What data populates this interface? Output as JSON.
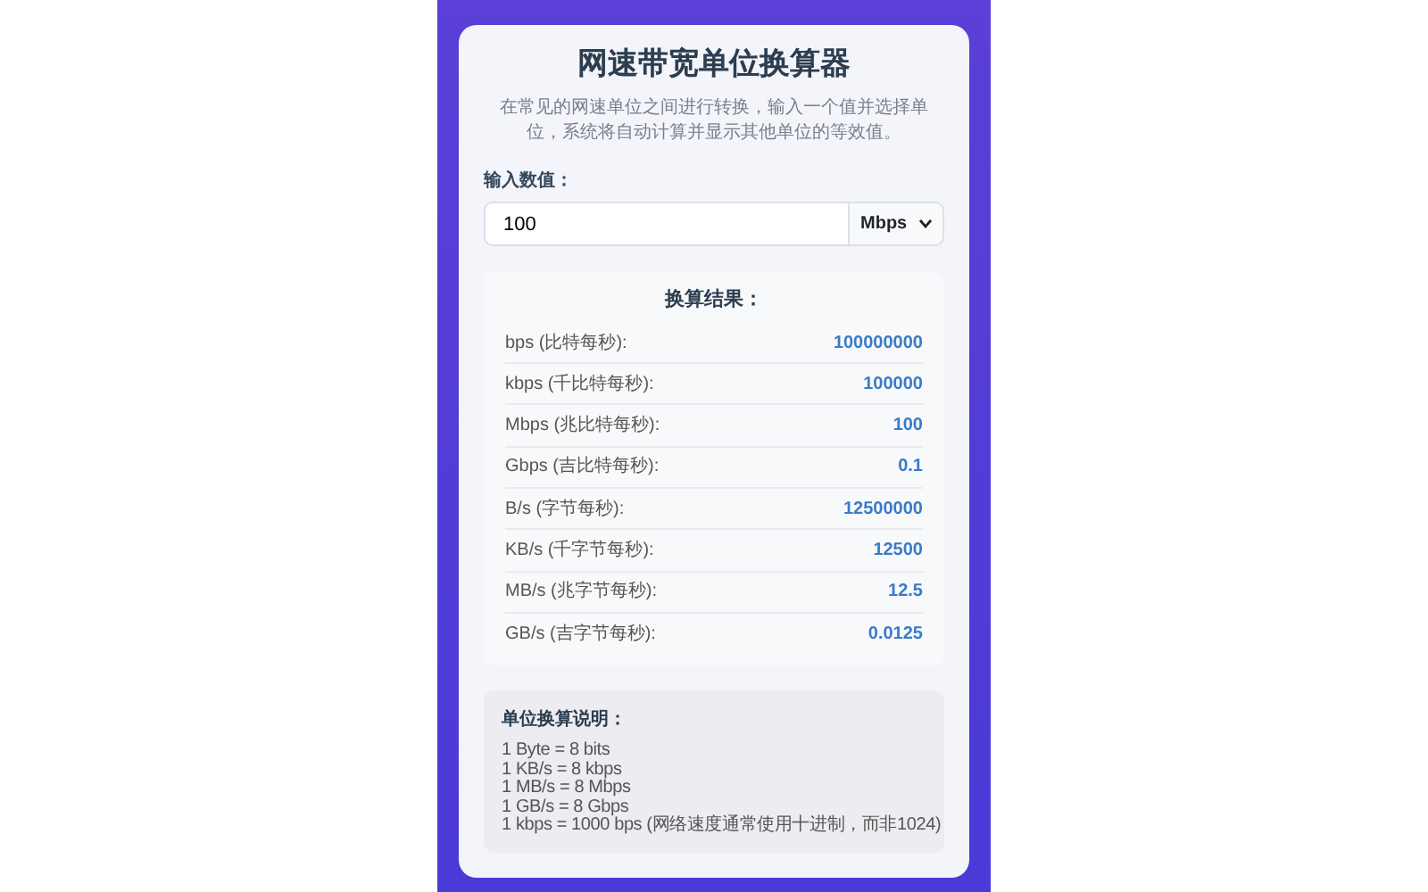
{
  "title": "网速带宽单位换算器",
  "description": "在常见的网速单位之间进行转换，输入一个值并选择单位，系统将自动计算并显示其他单位的等效值。",
  "input": {
    "label": "输入数值：",
    "value": "100",
    "unit": "Mbps"
  },
  "results": {
    "title": "换算结果：",
    "rows": [
      {
        "label": "bps (比特每秒):",
        "value": "100000000"
      },
      {
        "label": "kbps (千比特每秒):",
        "value": "100000"
      },
      {
        "label": "Mbps (兆比特每秒):",
        "value": "100"
      },
      {
        "label": "Gbps (吉比特每秒):",
        "value": "0.1"
      },
      {
        "label": "B/s (字节每秒):",
        "value": "12500000"
      },
      {
        "label": "KB/s (千字节每秒):",
        "value": "12500"
      },
      {
        "label": "MB/s (兆字节每秒):",
        "value": "12.5"
      },
      {
        "label": "GB/s (吉字节每秒):",
        "value": "0.0125"
      }
    ]
  },
  "notes": {
    "title": "单位换算说明：",
    "lines": [
      "1 Byte = 8 bits",
      "1 KB/s = 8 kbps",
      "1 MB/s = 8 Mbps",
      "1 GB/s = 8 Gbps",
      "1 kbps = 1000 bps (网络速度通常使用十进制，而非1024)"
    ]
  }
}
